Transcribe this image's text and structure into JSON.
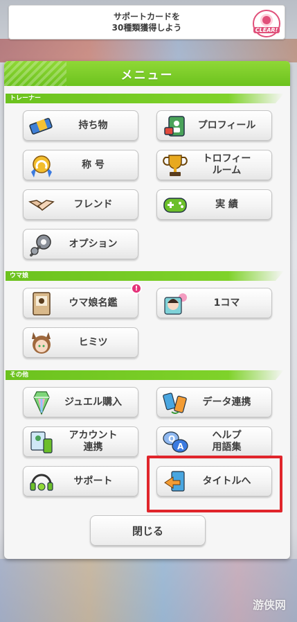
{
  "mission": {
    "text": "サポートカードを\n30種類獲得しよう",
    "badge": "CLEAR!"
  },
  "panel": {
    "title": "メニュー"
  },
  "sections": {
    "trainer": "トレーナー",
    "uma": "ウマ娘",
    "other": "その他"
  },
  "buttons": {
    "items": "持ち物",
    "profile": "プロフィール",
    "title": "称 号",
    "trophy": "トロフィー\nルーム",
    "friend": "フレンド",
    "achievement": "実 績",
    "option": "オプション",
    "encyclopedia": "ウマ娘名鑑",
    "encyclopedia_badge": "!",
    "koma": "1コマ",
    "secret": "ヒミツ",
    "jewel": "ジュエル購入",
    "data_link": "データ連携",
    "account": "アカウント\n連携",
    "help": "ヘルプ\n用語集",
    "support": "サポート",
    "to_title": "タイトルへ"
  },
  "close": "閉じる",
  "watermark": "游侠网",
  "colors": {
    "accent_green": "#6cc21e",
    "highlight_red": "#e0252b",
    "badge_pink": "#e5337a"
  }
}
